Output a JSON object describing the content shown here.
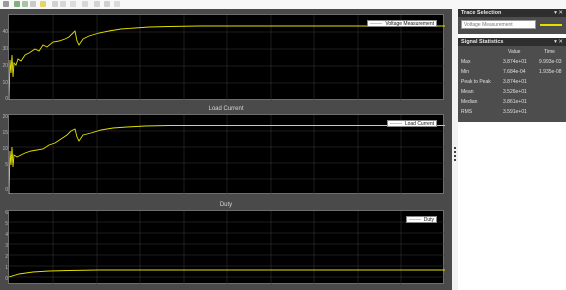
{
  "toolbar": {
    "buttons": [
      "settings-icon",
      "run-icon",
      "step-forward-icon",
      "stop-icon",
      "highlight-icon",
      "zoom-icon",
      "pan-icon",
      "autoscale-icon",
      "cursor-icon",
      "trigger-icon",
      "measure-icon",
      "layout-icon"
    ]
  },
  "plots": [
    {
      "title": "",
      "y_ticks": [
        "40",
        "30",
        "20",
        "10",
        "0"
      ],
      "legend": "Voltage Measurement"
    },
    {
      "title": "Load Current",
      "y_ticks": [
        "20",
        "15",
        "10",
        "5",
        "0"
      ],
      "legend": "Load Current"
    },
    {
      "title": "Duty",
      "y_ticks": [
        "6",
        "5",
        "4",
        "3",
        "2",
        "1",
        "0"
      ],
      "legend": "Duty"
    }
  ],
  "trace_selection": {
    "title": "Trace Selection",
    "controls": "▾ ✕",
    "selected": "Voltage Measurement"
  },
  "signal_statistics": {
    "title": "Signal Statistics",
    "controls": "▾ ✕",
    "col_value": "Value",
    "col_time": "Time",
    "rows": [
      {
        "label": "Max",
        "value": "3.874e+01",
        "time": "9.993e-03"
      },
      {
        "label": "Min",
        "value": "7.684e-04",
        "time": "1.935e-08"
      },
      {
        "label": "Peak to Peak",
        "value": "3.874e+01",
        "time": ""
      },
      {
        "label": "Mean",
        "value": "3.526e+01",
        "time": ""
      },
      {
        "label": "Median",
        "value": "3.861e+01",
        "time": ""
      },
      {
        "label": "RMS",
        "value": "3.591e+01",
        "time": ""
      }
    ]
  },
  "colors": {
    "trace": "#e3e000",
    "plot_bg": "#000000",
    "scope_bg": "#4a4a4a",
    "grid": "#3a3a3a"
  }
}
